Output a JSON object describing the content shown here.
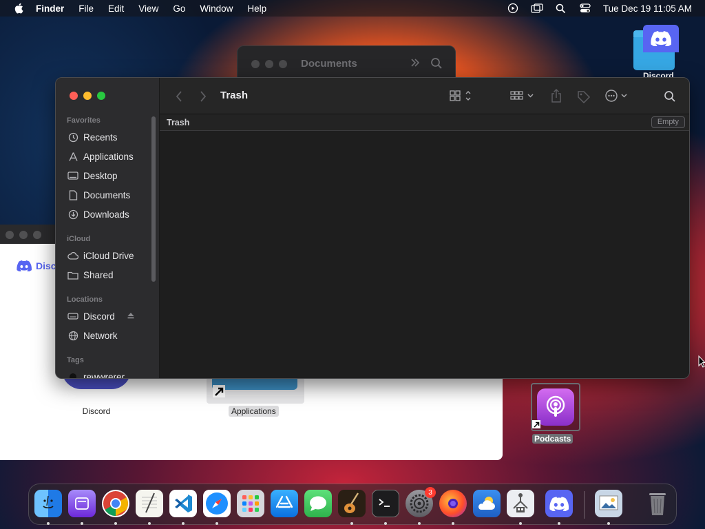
{
  "menubar": {
    "app_name": "Finder",
    "items": [
      "File",
      "Edit",
      "View",
      "Go",
      "Window",
      "Help"
    ],
    "clock": "Tue Dec 19  11:05 AM",
    "status_icons": [
      "screen-record-icon",
      "window-icon",
      "spotlight-search-icon",
      "control-center-icon"
    ]
  },
  "background_window": {
    "title": "Documents"
  },
  "white_window": {
    "brand": "Disc",
    "items": [
      {
        "label": "Discord"
      },
      {
        "label": "Applications"
      }
    ]
  },
  "finder": {
    "title": "Trash",
    "path_label": "Trash",
    "empty_button": "Empty",
    "sidebar": {
      "favorites_header": "Favorites",
      "favorites": [
        {
          "label": "Recents",
          "icon": "clock-icon"
        },
        {
          "label": "Applications",
          "icon": "applications-icon"
        },
        {
          "label": "Desktop",
          "icon": "desktop-icon"
        },
        {
          "label": "Documents",
          "icon": "document-icon"
        },
        {
          "label": "Downloads",
          "icon": "download-icon"
        }
      ],
      "icloud_header": "iCloud",
      "icloud": [
        {
          "label": "iCloud Drive",
          "icon": "cloud-icon"
        },
        {
          "label": "Shared",
          "icon": "shared-folder-icon"
        }
      ],
      "locations_header": "Locations",
      "locations": [
        {
          "label": "Discord",
          "icon": "disk-icon"
        },
        {
          "label": "Network",
          "icon": "globe-icon"
        }
      ],
      "tags_header": "Tags",
      "tags": [
        {
          "label": "rewwrerer",
          "color": "#1a1a1a"
        }
      ]
    }
  },
  "desktop": {
    "discord_folder": "Discord",
    "podcasts": "Podcasts"
  },
  "dock": {
    "items": [
      {
        "name": "finder",
        "color": "#2a7ff2"
      },
      {
        "name": "podcasts-purple",
        "color": "#8b5cf6"
      },
      {
        "name": "chrome",
        "color": "#ffffff"
      },
      {
        "name": "textedit",
        "color": "#f4f4f0"
      },
      {
        "name": "vscode",
        "color": "#1f8ad2"
      },
      {
        "name": "safari",
        "color": "#1e90ff"
      },
      {
        "name": "launchpad",
        "color": "#d0d0d6"
      },
      {
        "name": "app-store",
        "color": "#1c8cf0"
      },
      {
        "name": "messages",
        "color": "#34c759"
      },
      {
        "name": "garageband",
        "color": "#3a2a1a"
      },
      {
        "name": "terminal",
        "color": "#1a1a1a"
      },
      {
        "name": "system-settings",
        "color": "#7a7a80",
        "badge": "3"
      },
      {
        "name": "firefox",
        "color": "#ff6b2b"
      },
      {
        "name": "weather",
        "color": "#2e8be8"
      },
      {
        "name": "automator",
        "color": "#e6e6ea"
      },
      {
        "name": "discord",
        "color": "#5865f2"
      },
      {
        "name": "preview",
        "color": "#c8d6e6"
      },
      {
        "name": "trash",
        "color": "#6a6a70"
      }
    ]
  }
}
